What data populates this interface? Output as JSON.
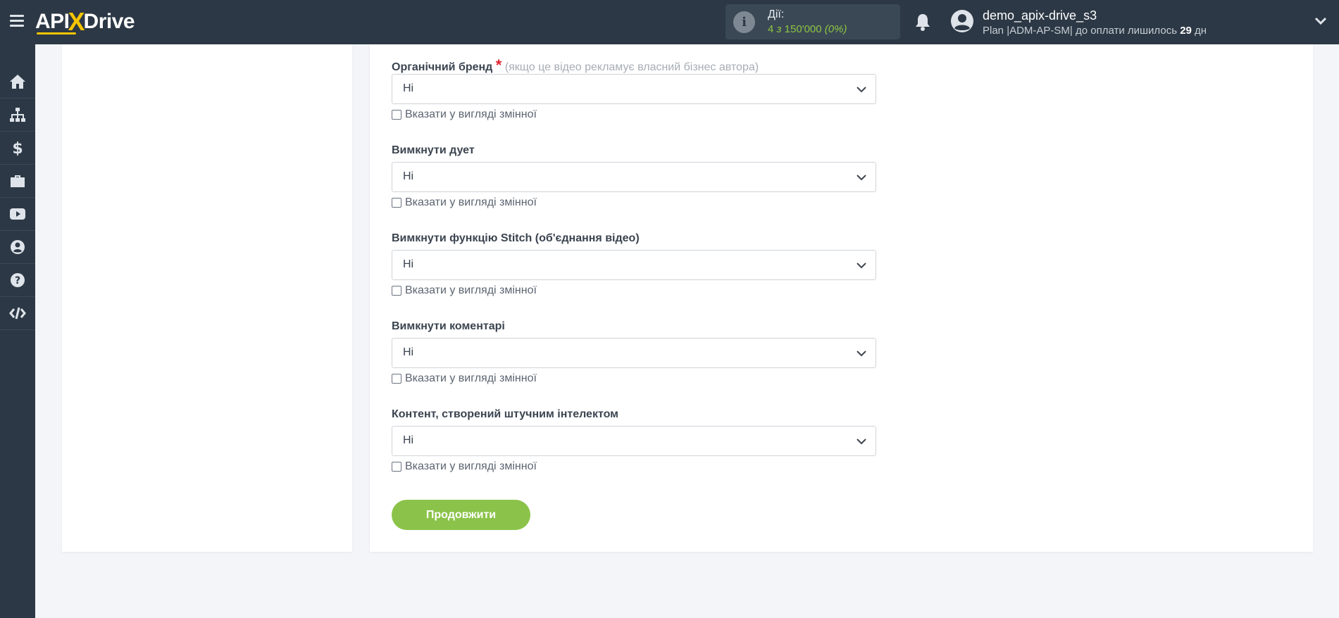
{
  "header": {
    "logo_part1": "API",
    "logo_x": "X",
    "logo_part2": "Drive",
    "actions_label": "Дії:",
    "actions_count": "4",
    "actions_of": "з",
    "actions_limit": "150'000",
    "actions_percent": "(0%)",
    "username": "demo_apix-drive_s3",
    "plan_text": "Plan |ADM-AP-SM| до оплати лишилось",
    "days_left": "29",
    "days_unit": "дн"
  },
  "sidebar": {
    "icons": [
      "home-icon",
      "sitemap-icon",
      "dollar-icon",
      "briefcase-icon",
      "youtube-icon",
      "user-circle-icon",
      "help-icon",
      "code-icon"
    ]
  },
  "form": {
    "fields": [
      {
        "label": "Органічний бренд",
        "required": true,
        "hint": "(якщо це відео рекламує власний бізнес автора)",
        "value": "Ні",
        "var_label": "Вказати у вигляді змінної"
      },
      {
        "label": "Вимкнути дует",
        "required": false,
        "hint": "",
        "value": "Ні",
        "var_label": "Вказати у вигляді змінної"
      },
      {
        "label": "Вимкнути функцію Stitch (об'єднання відео)",
        "required": false,
        "hint": "",
        "value": "Ні",
        "var_label": "Вказати у вигляді змінної"
      },
      {
        "label": "Вимкнути коментарі",
        "required": false,
        "hint": "",
        "value": "Ні",
        "var_label": "Вказати у вигляді змінної"
      },
      {
        "label": "Контент, створений штучним інтелектом",
        "required": false,
        "hint": "",
        "value": "Ні",
        "var_label": "Вказати у вигляді змінної"
      }
    ],
    "required_mark": "*",
    "continue_label": "Продовжити"
  },
  "colors": {
    "topbar": "#2c3845",
    "accent_green": "#8bc34a",
    "logo_yellow": "#f5c400",
    "required_red": "#e0262f"
  }
}
